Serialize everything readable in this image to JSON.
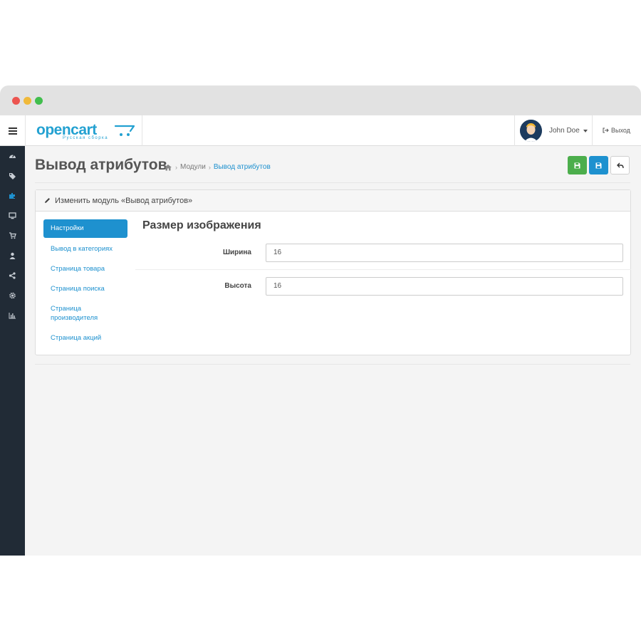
{
  "window": {
    "controls": [
      "close",
      "minimize",
      "maximize"
    ]
  },
  "header": {
    "logo": {
      "name": "opencart",
      "subtitle": "Русская сборка",
      "icon": "cart-icon"
    },
    "user": {
      "name": "John Doe",
      "avatar": "avatar-icon"
    },
    "logout_label": "Выход"
  },
  "sidebar": {
    "icons": [
      "dashboard-icon",
      "tag-icon",
      "puzzle-icon",
      "desktop-icon",
      "cart-icon",
      "user-icon",
      "share-icon",
      "cog-icon",
      "bar-chart-icon"
    ]
  },
  "page": {
    "title": "Вывод атрибутов",
    "breadcrumb": [
      "Модули",
      "Вывод атрибутов"
    ]
  },
  "panel": {
    "heading": "Изменить модуль «Вывод атрибутов»",
    "nav": [
      "Настройки",
      "Вывод в категориях",
      "Страница товара",
      "Страница поиска",
      "Страница производителя",
      "Страница акций"
    ],
    "section_title": "Размер изображения",
    "fields": [
      {
        "label": "Ширина",
        "value": "16"
      },
      {
        "label": "Высота",
        "value": "16"
      }
    ]
  },
  "colors": {
    "primary": "#1e91cf",
    "success": "#4cae4c",
    "sidebar": "#212b36"
  }
}
